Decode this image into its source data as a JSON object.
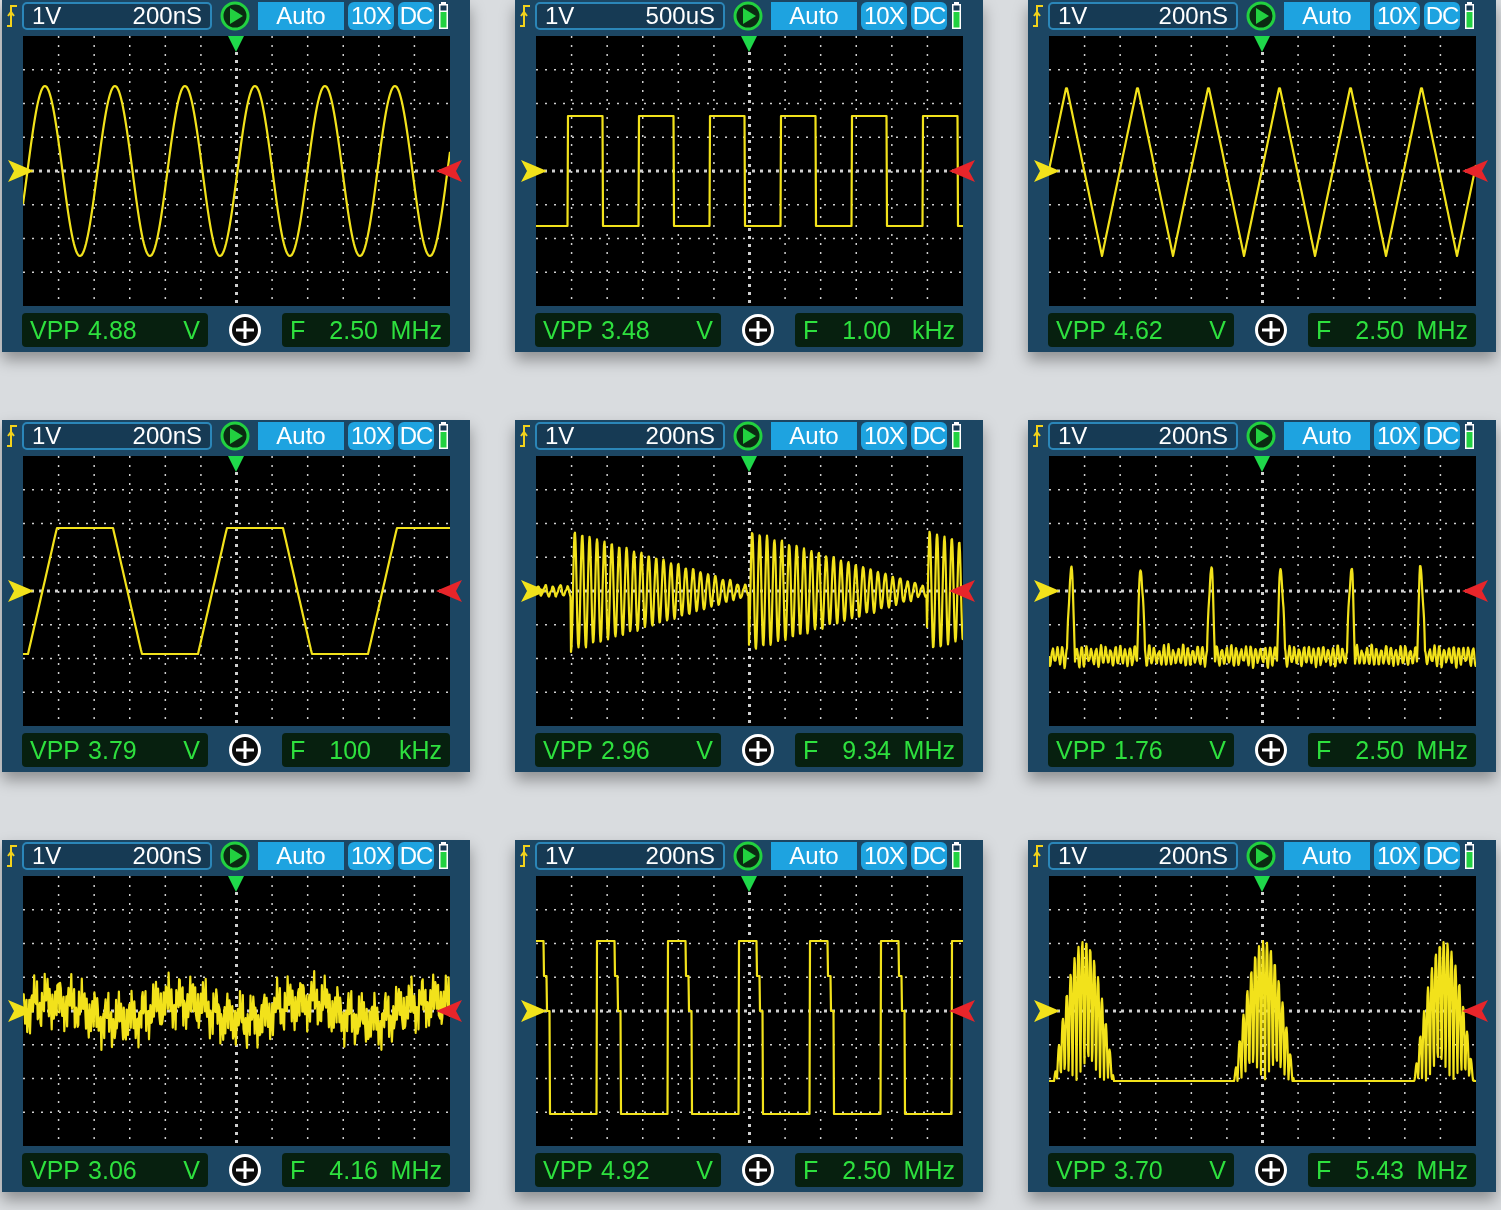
{
  "scopes": [
    {
      "volts": "1V",
      "timebase": "200nS",
      "mode": "Auto",
      "probe": "10X",
      "coupling": "DC",
      "vpp_label": "VPP",
      "vpp_value": "4.88",
      "vpp_unit": "V",
      "f_label": "F",
      "f_value": "2.50",
      "f_unit": "MHz",
      "kind": "sine"
    },
    {
      "volts": "1V",
      "timebase": "500uS",
      "mode": "Auto",
      "probe": "10X",
      "coupling": "DC",
      "vpp_label": "VPP",
      "vpp_value": "3.48",
      "vpp_unit": "V",
      "f_label": "F",
      "f_value": "1.00",
      "f_unit": "kHz",
      "kind": "square"
    },
    {
      "volts": "1V",
      "timebase": "200nS",
      "mode": "Auto",
      "probe": "10X",
      "coupling": "DC",
      "vpp_label": "VPP",
      "vpp_value": "4.62",
      "vpp_unit": "V",
      "f_label": "F",
      "f_value": "2.50",
      "f_unit": "MHz",
      "kind": "triangle"
    },
    {
      "volts": "1V",
      "timebase": "200nS",
      "mode": "Auto",
      "probe": "10X",
      "coupling": "DC",
      "vpp_label": "VPP",
      "vpp_value": "3.79",
      "vpp_unit": "V",
      "f_label": "F",
      "f_value": "100",
      "f_unit": "kHz",
      "kind": "trapezoid"
    },
    {
      "volts": "1V",
      "timebase": "200nS",
      "mode": "Auto",
      "probe": "10X",
      "coupling": "DC",
      "vpp_label": "VPP",
      "vpp_value": "2.96",
      "vpp_unit": "V",
      "f_label": "F",
      "f_value": "9.34",
      "f_unit": "MHz",
      "kind": "decay"
    },
    {
      "volts": "1V",
      "timebase": "200nS",
      "mode": "Auto",
      "probe": "10X",
      "coupling": "DC",
      "vpp_label": "VPP",
      "vpp_value": "1.76",
      "vpp_unit": "V",
      "f_label": "F",
      "f_value": "2.50",
      "f_unit": "MHz",
      "kind": "spikes"
    },
    {
      "volts": "1V",
      "timebase": "200nS",
      "mode": "Auto",
      "probe": "10X",
      "coupling": "DC",
      "vpp_label": "VPP",
      "vpp_value": "3.06",
      "vpp_unit": "V",
      "f_label": "F",
      "f_value": "4.16",
      "f_unit": "MHz",
      "kind": "noise"
    },
    {
      "volts": "1V",
      "timebase": "200nS",
      "mode": "Auto",
      "probe": "10X",
      "coupling": "DC",
      "vpp_label": "VPP",
      "vpp_value": "4.92",
      "vpp_unit": "V",
      "f_label": "F",
      "f_value": "2.50",
      "f_unit": "MHz",
      "kind": "pulse"
    },
    {
      "volts": "1V",
      "timebase": "200nS",
      "mode": "Auto",
      "probe": "10X",
      "coupling": "DC",
      "vpp_label": "VPP",
      "vpp_value": "3.70",
      "vpp_unit": "V",
      "f_label": "F",
      "f_value": "5.43",
      "f_unit": "MHz",
      "kind": "bursts"
    }
  ]
}
